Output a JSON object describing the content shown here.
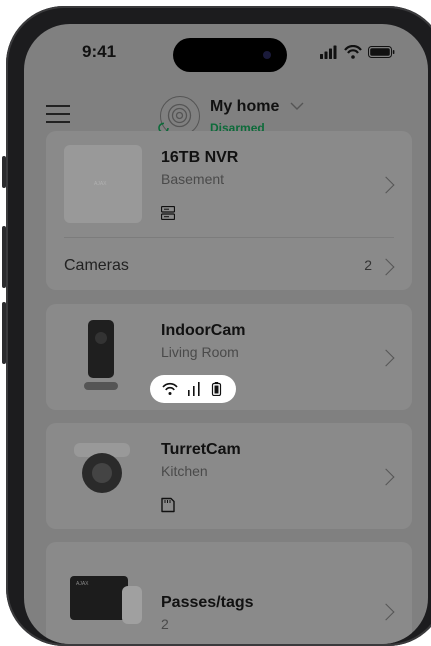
{
  "status_bar": {
    "time": "9:41"
  },
  "header": {
    "home_title": "My home",
    "home_status": "Disarmed",
    "status_color": "#0d6b3a"
  },
  "devices": [
    {
      "title": "16TB NVR",
      "subtitle": "Basement",
      "icon": "server-icon",
      "thumb_brand": "AJAX"
    },
    {
      "title": "IndoorCam",
      "subtitle": "Living Room",
      "icons": [
        "wifi-icon",
        "signal-bars-icon",
        "battery-icon"
      ]
    },
    {
      "title": "TurretCam",
      "subtitle": "Kitchen",
      "icon": "sd-card-icon"
    },
    {
      "title": "Passes/tags",
      "subtitle": "2",
      "thumb_brand": "AJAX"
    }
  ],
  "cameras_row": {
    "label": "Cameras",
    "count": "2"
  },
  "colors": {
    "overlay": "#808080",
    "card": "#8a8a8a",
    "badge": "#ffffff"
  }
}
